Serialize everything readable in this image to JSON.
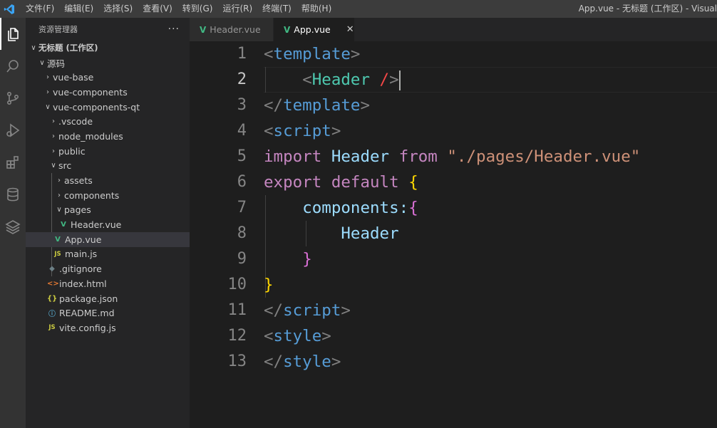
{
  "menu": [
    "文件(F)",
    "编辑(E)",
    "选择(S)",
    "查看(V)",
    "转到(G)",
    "运行(R)",
    "终端(T)",
    "帮助(H)"
  ],
  "window_title": "App.vue - 无标题 (工作区) - Visual",
  "explorer": {
    "title": "资源管理器",
    "more": "···",
    "workspace": "无标题 (工作区)",
    "root": "源码",
    "items": {
      "vue_base": "vue-base",
      "vue_components": "vue-components",
      "vue_components_qt": "vue-components-qt",
      "vscode": ".vscode",
      "node_modules": "node_modules",
      "public": "public",
      "src": "src",
      "assets": "assets",
      "components": "components",
      "pages": "pages",
      "header_vue": "Header.vue",
      "app_vue": "App.vue",
      "main_js": "main.js",
      "gitignore": ".gitignore",
      "index_html": "index.html",
      "package_json": "package.json",
      "readme": "README.md",
      "vite_config": "vite.config.js"
    }
  },
  "tabs": [
    {
      "label": "Header.vue",
      "active": false
    },
    {
      "label": "App.vue",
      "active": true
    }
  ],
  "line_numbers": [
    "1",
    "2",
    "3",
    "4",
    "5",
    "6",
    "7",
    "8",
    "9",
    "10",
    "11",
    "12",
    "13"
  ],
  "code": {
    "l1": {
      "open": "<",
      "tag": "template",
      "close": ">"
    },
    "l2": {
      "open": "<",
      "comp": "Header",
      "slash": " /",
      "close": ">"
    },
    "l3": {
      "open": "</",
      "tag": "template",
      "close": ">"
    },
    "l4": {
      "open": "<",
      "tag": "script",
      "close": ">"
    },
    "l5": {
      "kw1": "import",
      "name": "Header",
      "kw2": "from",
      "str": "\"./pages/Header.vue\""
    },
    "l6": {
      "kw1": "export",
      "kw2": "default",
      "brace": "{"
    },
    "l7": {
      "prop": "components:",
      "brace": "{"
    },
    "l8": {
      "name": "Header"
    },
    "l9": {
      "brace": "}"
    },
    "l10": {
      "brace": "}"
    },
    "l11": {
      "open": "</",
      "tag": "script",
      "close": ">"
    },
    "l12": {
      "open": "<",
      "tag": "style",
      "close": ">"
    },
    "l13": {
      "open": "</",
      "tag": "style",
      "close": ">"
    }
  },
  "colors": {
    "vue_green": "#41b883",
    "tag_blue": "#569cd6",
    "keyword_purple": "#c586c0",
    "component_teal": "#4ec9b0",
    "string_orange": "#ce9178",
    "brace_gold": "#ffd700"
  },
  "icons": {
    "activity": [
      "explorer-icon",
      "search-icon",
      "source-control-icon",
      "run-debug-icon",
      "extensions-icon",
      "database-icon",
      "layers-icon"
    ]
  }
}
